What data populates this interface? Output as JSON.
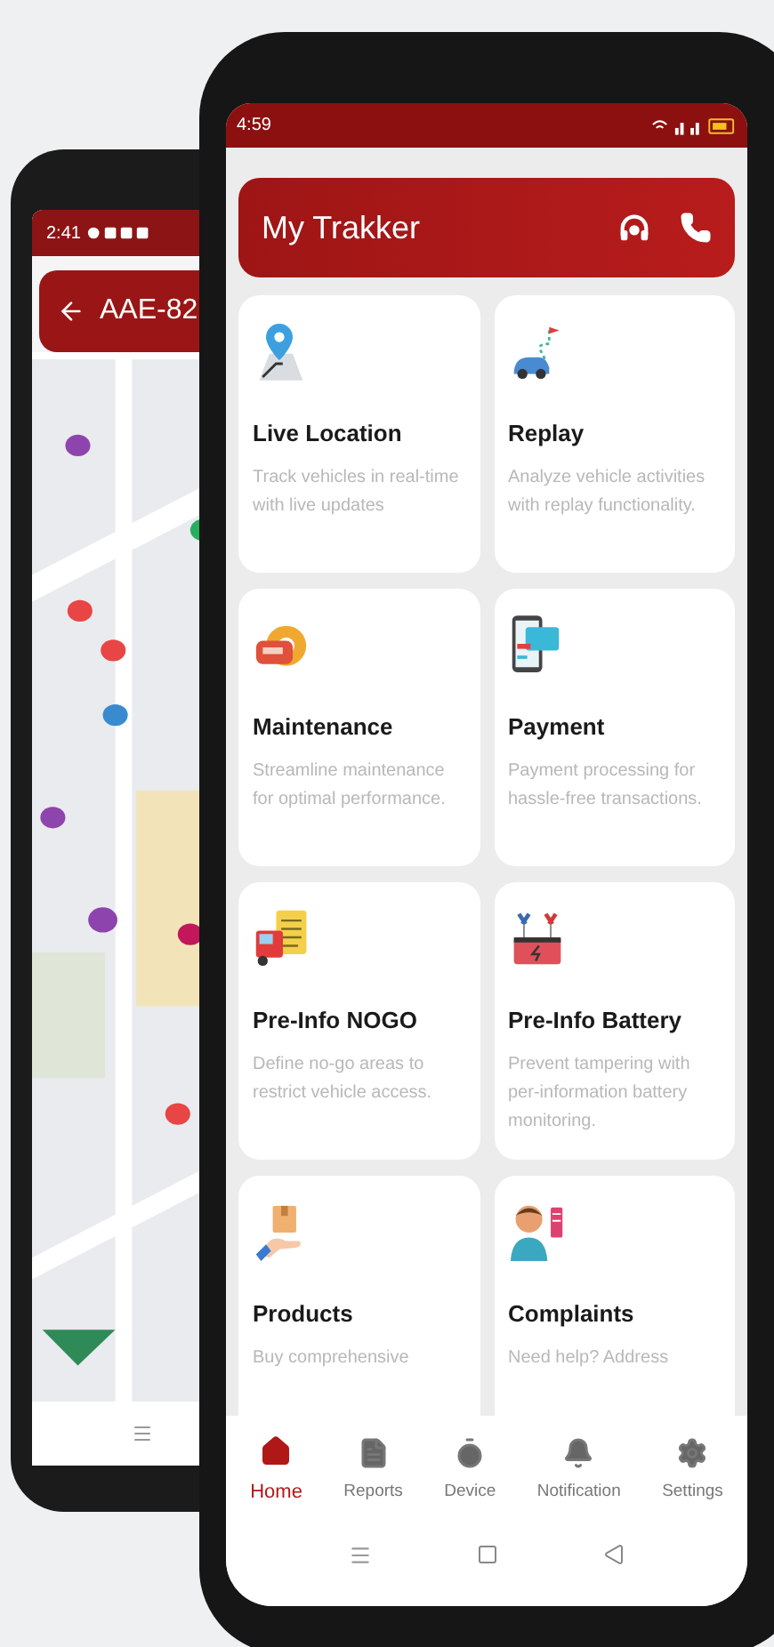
{
  "back_phone": {
    "status_time": "2:41",
    "header_title": "AAE-82"
  },
  "front_phone": {
    "status_time": "4:59",
    "app_title": "My Trakker",
    "cards": [
      {
        "title": "Live Location",
        "description": "Track vehicles in real-time with live updates"
      },
      {
        "title": "Replay",
        "description": "Analyze vehicle activities with replay functionality."
      },
      {
        "title": "Maintenance",
        "description": "Streamline maintenance for optimal performance."
      },
      {
        "title": "Payment",
        "description": "Payment processing for hassle-free transactions."
      },
      {
        "title": "Pre-Info NOGO",
        "description": "Define no-go areas to restrict vehicle access."
      },
      {
        "title": "Pre-Info Battery",
        "description": "Prevent tampering with per-information battery monitoring."
      },
      {
        "title": "Products",
        "description": "Buy comprehensive"
      },
      {
        "title": "Complaints",
        "description": "Need help? Address"
      }
    ],
    "nav": [
      {
        "label": "Home",
        "selected": true
      },
      {
        "label": "Reports",
        "selected": false
      },
      {
        "label": "Device",
        "selected": false
      },
      {
        "label": "Notification",
        "selected": false
      },
      {
        "label": "Settings",
        "selected": false
      }
    ]
  }
}
